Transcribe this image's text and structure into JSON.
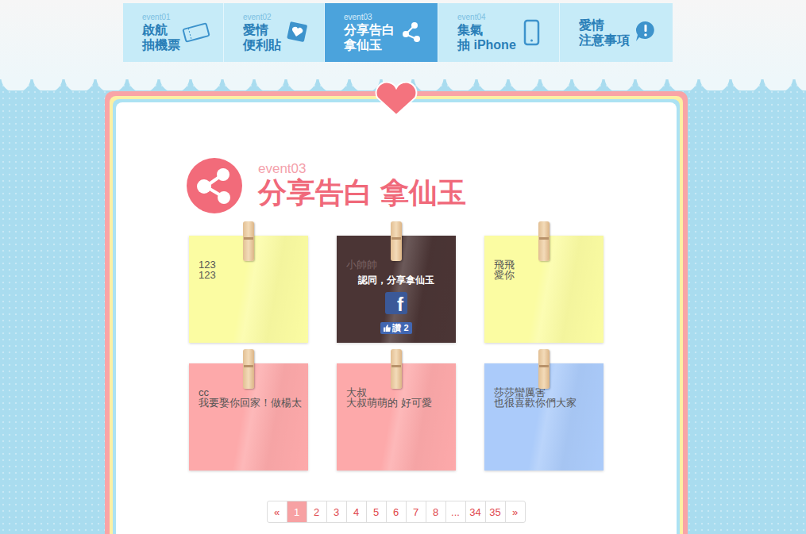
{
  "nav": {
    "tabs": [
      {
        "event": "event01",
        "lines": [
          "啟航",
          "抽機票"
        ],
        "selected": false
      },
      {
        "event": "event02",
        "lines": [
          "愛情",
          "便利貼"
        ],
        "selected": false
      },
      {
        "event": "event03",
        "lines": [
          "分享告白",
          "拿仙玉"
        ],
        "selected": true
      },
      {
        "event": "event04",
        "lines": [
          "集氣",
          "抽 iPhone"
        ],
        "selected": false
      },
      {
        "lines": [
          "愛情",
          "注意事項"
        ],
        "selected": false
      }
    ]
  },
  "section": {
    "event": "event03",
    "title": "分享告白 拿仙玉"
  },
  "notes": [
    {
      "lines": [
        "123",
        "123"
      ],
      "color": "#fbfca2",
      "highlighted": false
    },
    {
      "lines": [
        "小帥帥"
      ],
      "color": "#4b3535",
      "highlighted": true,
      "overlay": {
        "title": "認同，分享拿仙玉",
        "share": "f",
        "like": "讚 2"
      }
    },
    {
      "lines": [
        "飛飛",
        "愛你"
      ],
      "color": "#fbfca2",
      "highlighted": false
    },
    {
      "lines": [
        "cc",
        "我要娶你回家！做楊太"
      ],
      "color": "#fda9aa",
      "highlighted": false
    },
    {
      "lines": [
        "大叔",
        "大叔萌萌的 好可愛"
      ],
      "color": "#fda9aa",
      "highlighted": false
    },
    {
      "lines": [
        "莎莎蠻厲害",
        "也很喜歡你們大家"
      ],
      "color": "#abcbfa",
      "highlighted": false
    }
  ],
  "pagination": [
    {
      "label": "«",
      "selected": false
    },
    {
      "label": "1",
      "selected": true
    },
    {
      "label": "2",
      "selected": false
    },
    {
      "label": "3",
      "selected": false
    },
    {
      "label": "4",
      "selected": false
    },
    {
      "label": "5",
      "selected": false
    },
    {
      "label": "6",
      "selected": false
    },
    {
      "label": "7",
      "selected": false
    },
    {
      "label": "8",
      "selected": false
    },
    {
      "label": "...",
      "selected": false
    },
    {
      "label": "34",
      "selected": false
    },
    {
      "label": "35",
      "selected": false
    },
    {
      "label": "»",
      "selected": false
    }
  ]
}
